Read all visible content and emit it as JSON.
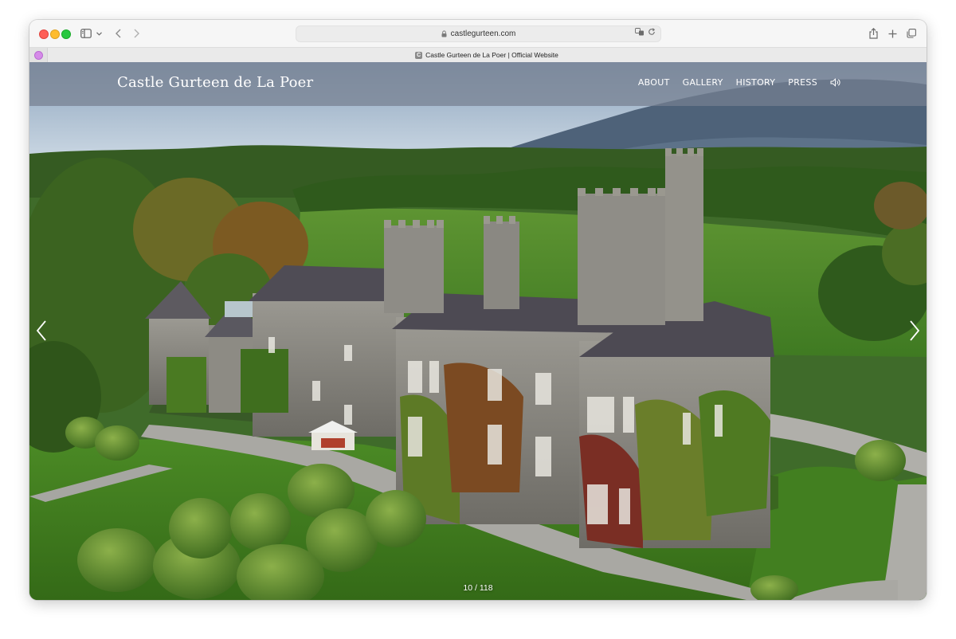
{
  "browser": {
    "url": "castlegurteen.com",
    "tab_title": "Castle Gurteen de La Poer | Official Website",
    "favicon_letter": "C"
  },
  "site": {
    "title": "Castle Gurteen de La Poer",
    "nav": [
      "ABOUT",
      "GALLERY",
      "HISTORY",
      "PRESS"
    ],
    "sound_icon": "speaker-icon"
  },
  "slideshow": {
    "counter": "10 / 118",
    "current": 10,
    "total": 118
  },
  "colors": {
    "header_overlay": "#76808f",
    "traffic_red": "#fe5f57",
    "traffic_yellow": "#febc2e",
    "traffic_green": "#28c840"
  }
}
